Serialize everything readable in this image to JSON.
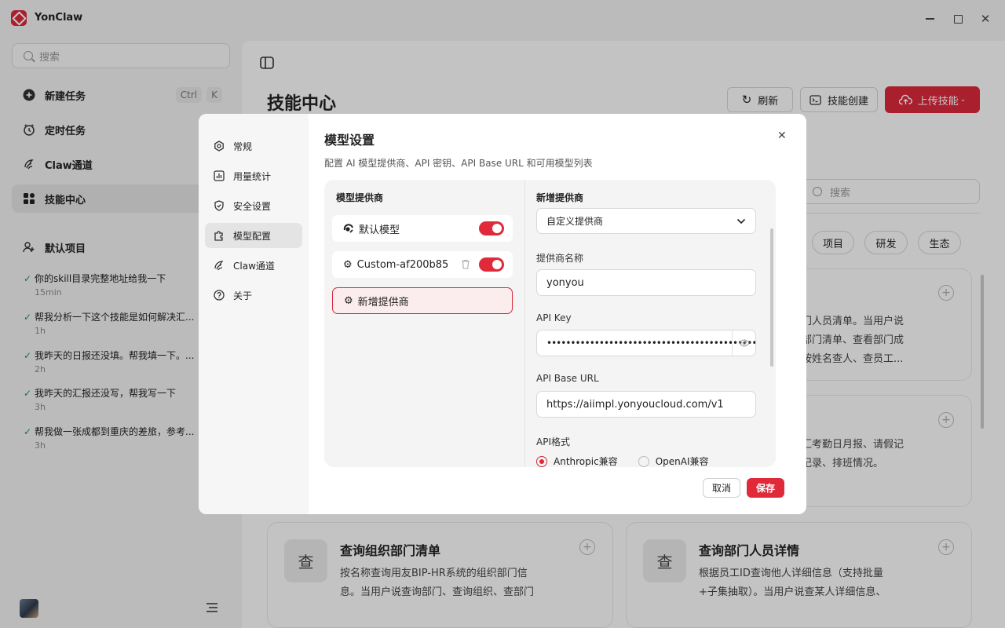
{
  "app": {
    "title": "YonClaw"
  },
  "window": {
    "minimize": "—",
    "maximize": "☐",
    "close": "✕"
  },
  "sidebar": {
    "search_placeholder": "搜索",
    "nav": [
      {
        "label": "新建任务",
        "shortcut": [
          "Ctrl",
          "K"
        ]
      },
      {
        "label": "定时任务"
      },
      {
        "label": "Claw通道"
      },
      {
        "label": "技能中心"
      }
    ],
    "project": "默认项目",
    "tasks": [
      {
        "title": "你的skill目录完整地址给我一下",
        "time": "15min"
      },
      {
        "title": "帮我分析一下这个技能是如何解决汇...",
        "time": "1h"
      },
      {
        "title": "我昨天的日报还没填。帮我填一下。...",
        "time": "2h"
      },
      {
        "title": "我昨天的汇报还没写，帮我写一下",
        "time": "3h"
      },
      {
        "title": "帮我做一张成都到重庆的差旅，参考...",
        "time": "3h"
      }
    ]
  },
  "main": {
    "title": "技能中心",
    "buttons": {
      "refresh": "刷新",
      "create": "技能创建",
      "upload": "上传技能"
    },
    "search_placeholder": "搜索",
    "filters": [
      "项目",
      "研发",
      "生态"
    ],
    "card_snippets": {
      "c1": [
        "门人员清单。当用户说",
        "部门清单、查看部门成",
        "按姓名查人、查员工..."
      ],
      "c2": [
        "汇考勤日月报、请假记",
        "记录、排班情况。"
      ]
    },
    "cards": [
      {
        "icon_char": "查",
        "title": "查询组织部门清单",
        "desc": [
          "按名称查询用友BIP-HR系统的组织部门信",
          "息。当用户说查询部门、查询组织、查部门"
        ]
      },
      {
        "icon_char": "查",
        "title": "查询部门人员详情",
        "desc": [
          "根据员工ID查询他人详细信息（支持批量",
          "+子集抽取）。当用户说查某人详细信息、"
        ]
      }
    ]
  },
  "modal": {
    "menu": [
      "常规",
      "用量统计",
      "安全设置",
      "模型配置",
      "Claw通道",
      "关于"
    ],
    "title": "模型设置",
    "subtitle": "配置 AI 模型提供商、API 密钥、API Base URL 和可用模型列表",
    "providers_heading": "模型提供商",
    "providers": [
      {
        "name": "默认模型",
        "enabled": true
      },
      {
        "name": "Custom-af200b85",
        "enabled": true
      }
    ],
    "add_provider": "新增提供商",
    "form": {
      "heading": "新增提供商",
      "type_value": "自定义提供商",
      "name_label": "提供商名称",
      "name_value": "yonyou",
      "key_label": "API Key",
      "key_value": "•••••••••••••••••••••••••••••••••••••••••••••",
      "base_label": "API Base URL",
      "base_value": "https://aiimpl.yonyoucloud.com/v1",
      "format_label": "API格式",
      "format_options": [
        "Anthropic兼容",
        "OpenAI兼容"
      ],
      "format_selected": "Anthropic兼容"
    },
    "cancel": "取消",
    "save": "保存"
  },
  "colors": {
    "accent": "#d9283a",
    "toggle_on": "#e02a3a",
    "check": "#1a9a43"
  }
}
